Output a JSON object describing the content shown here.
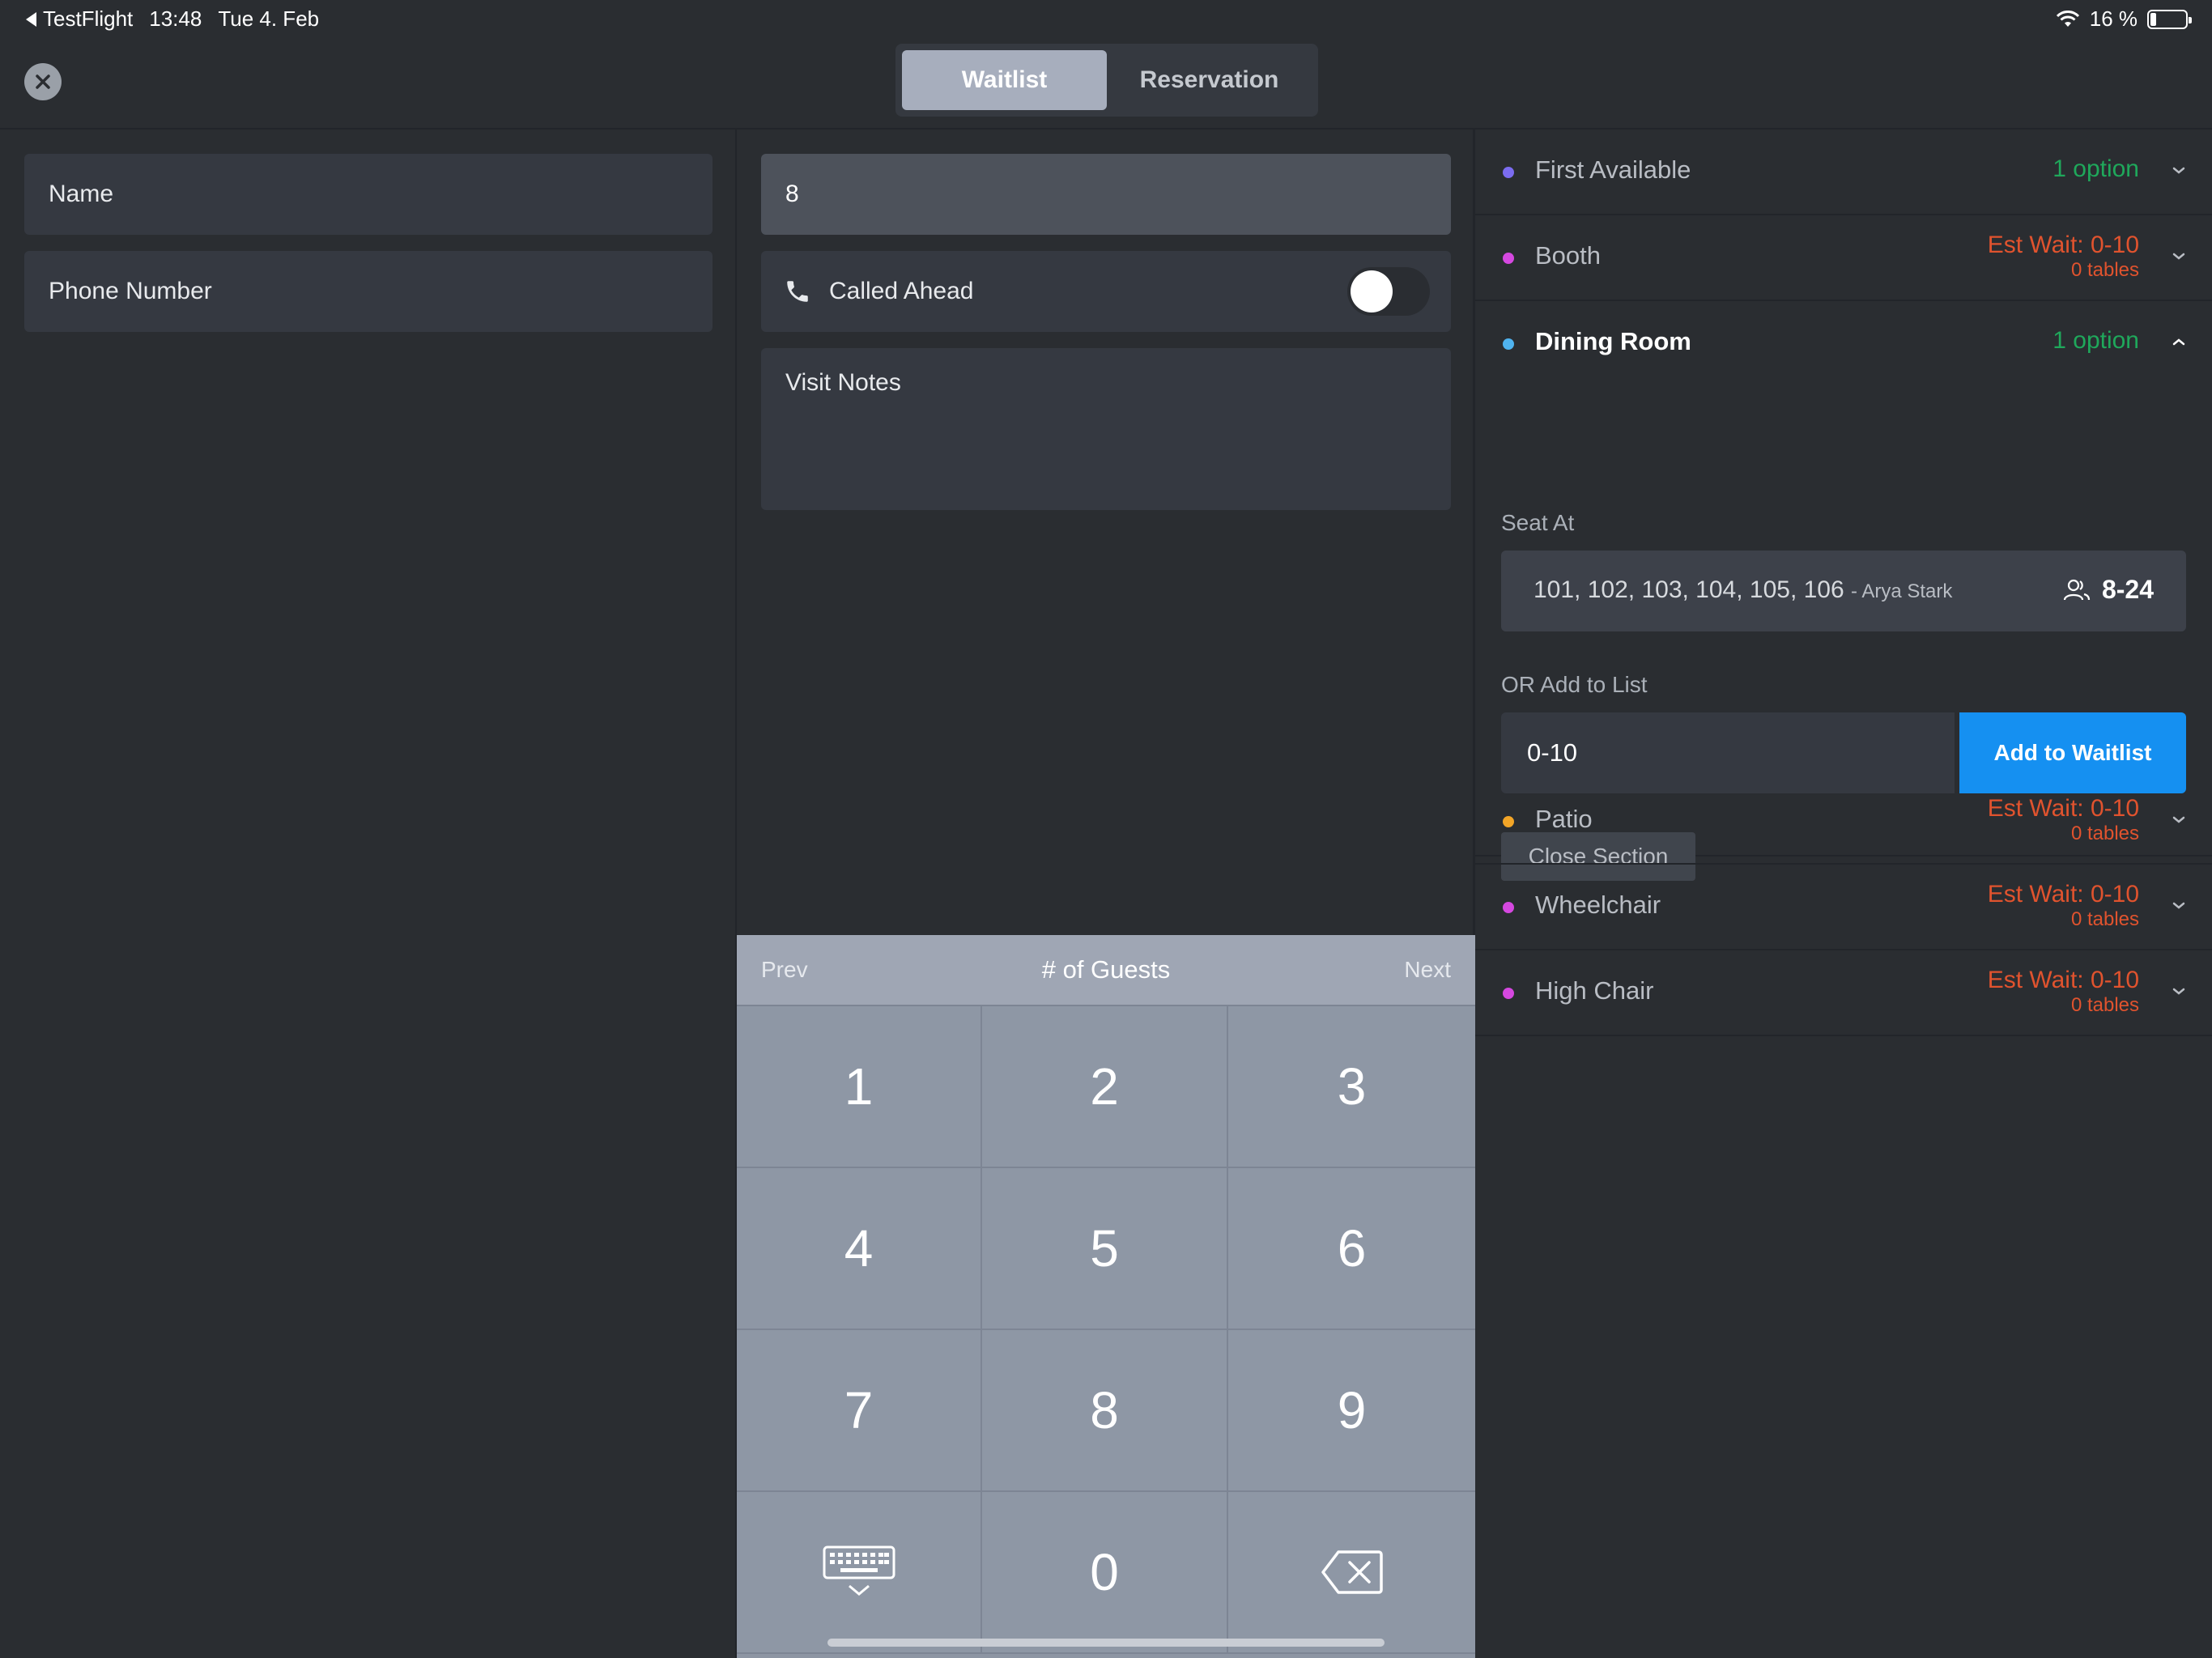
{
  "status_bar": {
    "back_app": "TestFlight",
    "time": "13:48",
    "date": "Tue 4. Feb",
    "battery_text": "16 %",
    "battery_level": 0.16
  },
  "header": {
    "tabs": [
      {
        "label": "Waitlist",
        "active": true
      },
      {
        "label": "Reservation",
        "active": false
      }
    ]
  },
  "form": {
    "name_placeholder": "Name",
    "phone_placeholder": "Phone Number",
    "guests_value": "8",
    "called_ahead_label": "Called Ahead",
    "called_ahead_on": false,
    "visit_notes_placeholder": "Visit Notes"
  },
  "keypad": {
    "prev": "Prev",
    "title": "# of Guests",
    "next": "Next",
    "keys": [
      "1",
      "2",
      "3",
      "4",
      "5",
      "6",
      "7",
      "8",
      "9",
      "keyboard-dismiss",
      "0",
      "backspace"
    ]
  },
  "sections": [
    {
      "name": "First Available",
      "color": "#7b6cf0",
      "status": "1 option",
      "status_type": "option",
      "expanded": false
    },
    {
      "name": "Booth",
      "color": "#d548e0",
      "wait": "Est Wait: 0-10",
      "tables": "0 tables",
      "status_type": "wait",
      "expanded": false
    },
    {
      "name": "Dining Room",
      "color": "#4fb3ef",
      "status": "1 option",
      "status_type": "option",
      "expanded": true
    },
    {
      "name": "Patio",
      "color": "#f2a527",
      "wait": "Est Wait: 0-10",
      "tables": "0 tables",
      "status_type": "wait",
      "expanded": false
    },
    {
      "name": "Wheelchair",
      "color": "#d548e0",
      "wait": "Est Wait: 0-10",
      "tables": "0 tables",
      "status_type": "wait",
      "expanded": false
    },
    {
      "name": "High Chair",
      "color": "#d548e0",
      "wait": "Est Wait: 0-10",
      "tables": "0 tables",
      "status_type": "wait",
      "expanded": false
    }
  ],
  "dining_room": {
    "seat_at_label": "Seat At",
    "seat_tables": "101, 102, 103, 104, 105, 106",
    "seat_host": "- Arya Stark",
    "seat_capacity": "8-24",
    "or_add_label": "OR Add to List",
    "wait_value": "0-10",
    "add_button": "Add to Waitlist",
    "close_section": "Close Section"
  }
}
